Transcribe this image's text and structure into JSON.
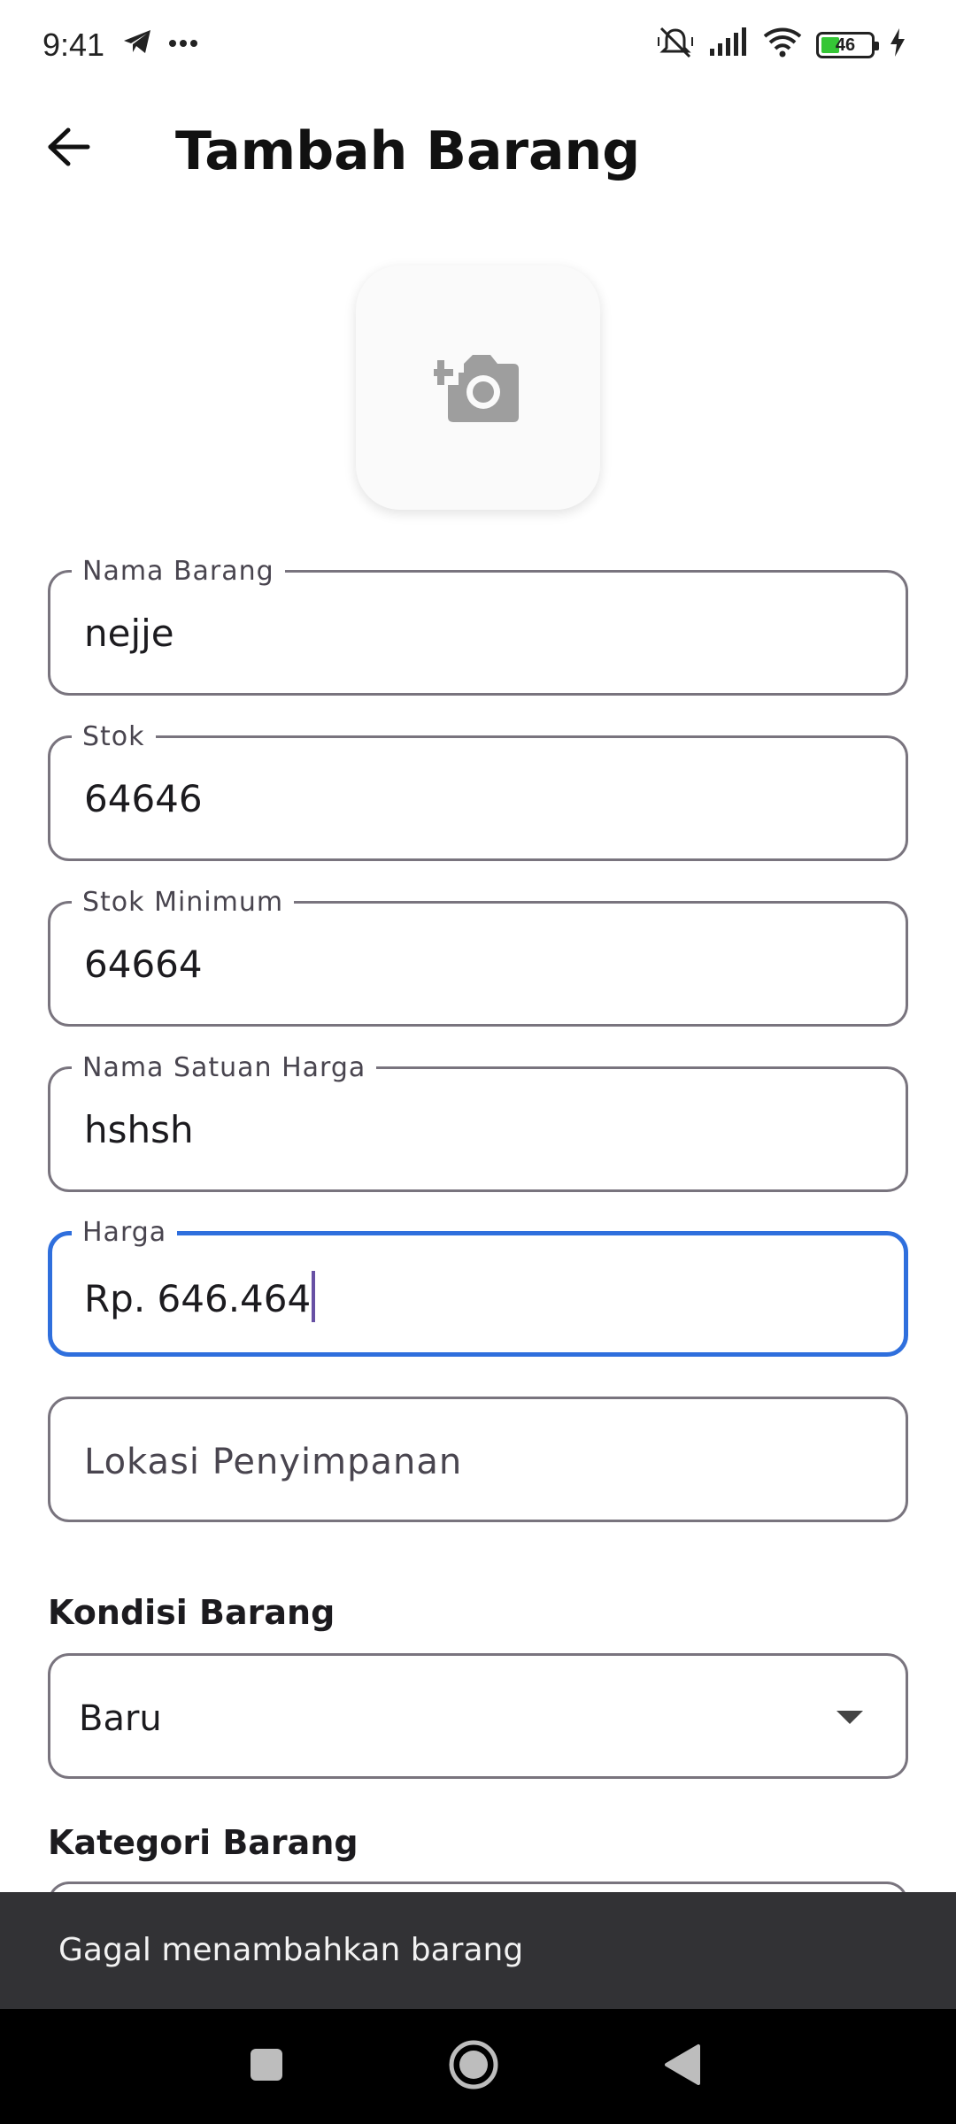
{
  "status_bar": {
    "time": "9:41",
    "battery_level": "46",
    "icons": [
      "telegram-icon",
      "more-icon",
      "mute-icon",
      "signal-icon",
      "wifi-icon",
      "battery-icon",
      "charging-icon"
    ]
  },
  "app_bar": {
    "title": "Tambah Barang",
    "back_icon": "arrow-left-icon"
  },
  "photo_picker": {
    "icon": "add-camera-icon"
  },
  "form": {
    "nama_barang": {
      "label": "Nama Barang",
      "value": "nejje"
    },
    "stok": {
      "label": "Stok",
      "value": "64646"
    },
    "stok_minimum": {
      "label": "Stok Minimum",
      "value": "64664"
    },
    "nama_satuan_harga": {
      "label": "Nama Satuan Harga",
      "value": "hshsh"
    },
    "harga": {
      "label": "Harga",
      "value": "Rp. 646.464"
    },
    "lokasi_penyimpanan": {
      "placeholder": "Lokasi Penyimpanan"
    },
    "kondisi_barang": {
      "label": "Kondisi Barang",
      "value": "Baru"
    },
    "kategori_barang": {
      "label": "Kategori Barang"
    }
  },
  "snackbar": {
    "message": "Gagal menambahkan barang"
  },
  "colors": {
    "focus_border": "#2f6fdd",
    "border": "#79747e",
    "snackbar_bg": "#323235",
    "battery_fill": "#35c636",
    "caret": "#6750a4"
  }
}
